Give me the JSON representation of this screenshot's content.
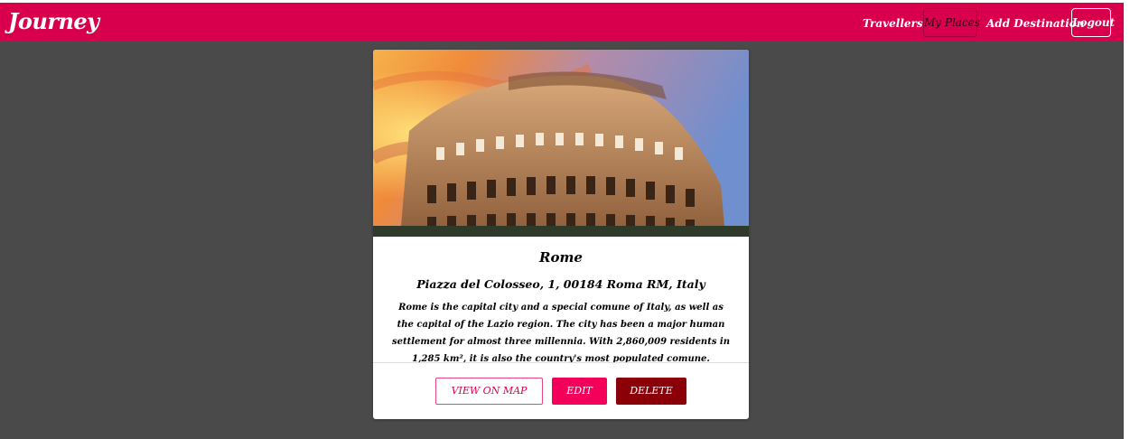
{
  "navbar": {
    "brand": "Journey",
    "links": [
      "Travellers",
      "My Places",
      "Add Destination",
      "Logout"
    ],
    "color": "#d8004c"
  },
  "place": {
    "title": "Rome",
    "address": "Piazza del Colosseo, 1, 00184 Roma RM, Italy",
    "description": "Rome is the capital city and a special comune of Italy, as well as the capital of the Lazio region. The city has been a major human settlement for almost three millennia. With 2,860,009 residents in 1,285 km², it is also the country's most populated comune.",
    "image": "colosseum-photo",
    "buttons": {
      "view_on_map": "VIEW ON MAP",
      "edit": "EDIT",
      "delete": "DELETE"
    }
  },
  "colors": {
    "background": "#4a4a4a",
    "edit": "#f4005a",
    "delete": "#8b0008"
  }
}
